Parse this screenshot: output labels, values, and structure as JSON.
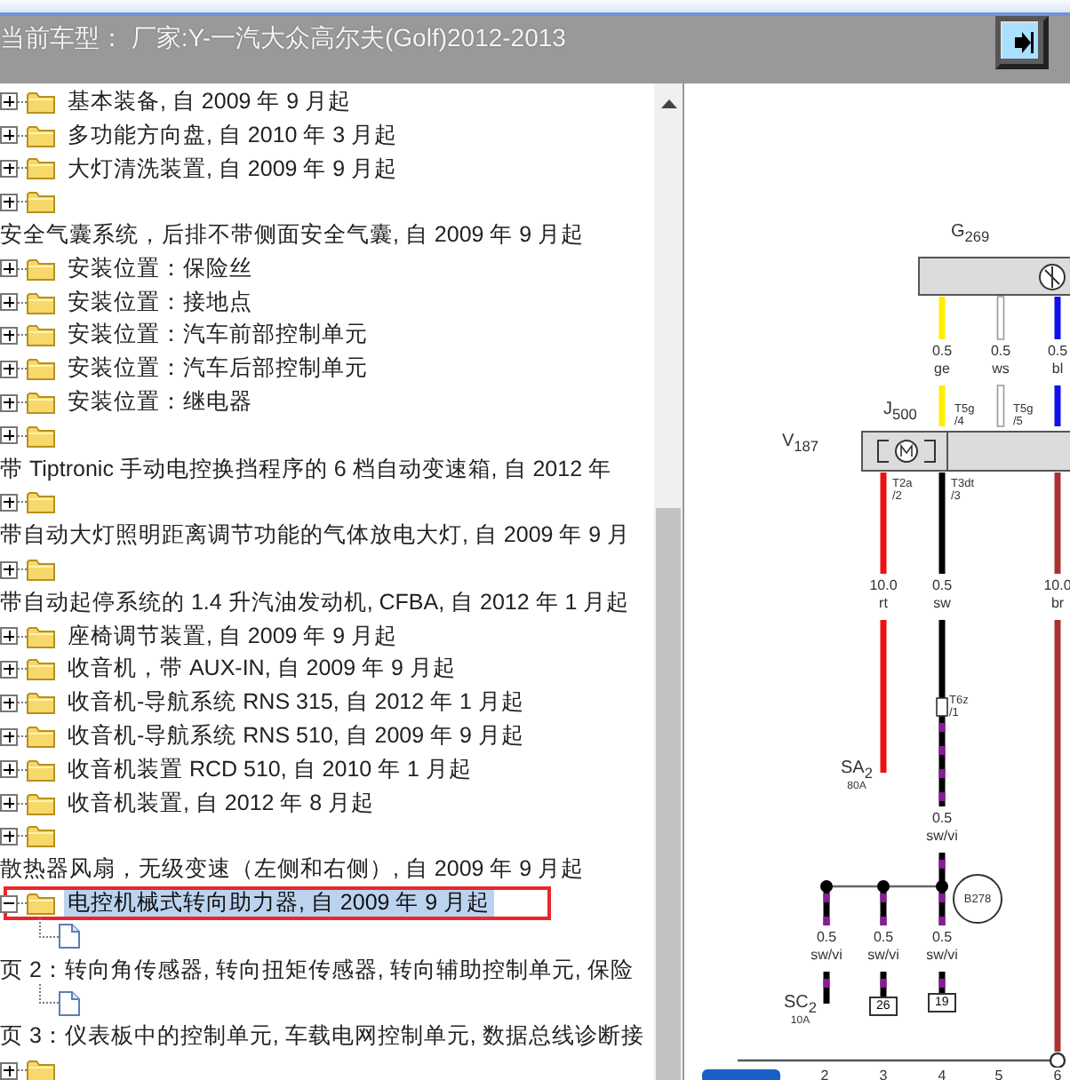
{
  "header": {
    "title": "当前车型： 厂家:Y-一汽大众高尔夫(Golf)2012-2013"
  },
  "tree": [
    {
      "kind": "folder",
      "label": "基本装备, 自 2009 年 9 月起",
      "expanded": false,
      "selected": false,
      "annotated": false
    },
    {
      "kind": "folder",
      "label": "多功能方向盘, 自 2010 年 3 月起",
      "expanded": false,
      "selected": false,
      "annotated": false
    },
    {
      "kind": "folder",
      "label": "大灯清洗装置, 自 2009 年 9 月起",
      "expanded": false,
      "selected": false,
      "annotated": false
    },
    {
      "kind": "folder",
      "expanded": false,
      "selected": false,
      "annotated": false
    },
    {
      "kind": "text",
      "label": "安全气囊系统，后排不带侧面安全气囊, 自 2009 年 9 月起"
    },
    {
      "kind": "folder",
      "label": "安装位置：保险丝",
      "expanded": false,
      "selected": false,
      "annotated": false
    },
    {
      "kind": "folder",
      "label": "安装位置：接地点",
      "expanded": false,
      "selected": false,
      "annotated": false
    },
    {
      "kind": "folder",
      "label": "安装位置：汽车前部控制单元",
      "expanded": false,
      "selected": false,
      "annotated": false
    },
    {
      "kind": "folder",
      "label": "安装位置：汽车后部控制单元",
      "expanded": false,
      "selected": false,
      "annotated": false
    },
    {
      "kind": "folder",
      "label": "安装位置：继电器",
      "expanded": false,
      "selected": false,
      "annotated": false
    },
    {
      "kind": "folder",
      "expanded": false,
      "selected": false,
      "annotated": false
    },
    {
      "kind": "text",
      "label": "带 Tiptronic 手动电控换挡程序的 6 档自动变速箱, 自 2012 年"
    },
    {
      "kind": "folder",
      "expanded": false,
      "selected": false,
      "annotated": false
    },
    {
      "kind": "text",
      "label": "带自动大灯照明距离调节功能的气体放电大灯, 自 2009 年 9 月"
    },
    {
      "kind": "folder",
      "expanded": false,
      "selected": false,
      "annotated": false
    },
    {
      "kind": "text",
      "label": "带自动起停系统的 1.4 升汽油发动机, CFBA, 自 2012 年 1 月起"
    },
    {
      "kind": "folder",
      "label": "座椅调节装置, 自 2009 年 9 月起",
      "expanded": false,
      "selected": false,
      "annotated": false
    },
    {
      "kind": "folder",
      "label": "收音机，带 AUX-IN, 自 2009 年 9 月起",
      "expanded": false,
      "selected": false,
      "annotated": false
    },
    {
      "kind": "folder",
      "label": "收音机-导航系统 RNS 315, 自 2012 年 1 月起",
      "expanded": false,
      "selected": false,
      "annotated": false
    },
    {
      "kind": "folder",
      "label": "收音机-导航系统 RNS 510, 自 2009 年 9 月起",
      "expanded": false,
      "selected": false,
      "annotated": false
    },
    {
      "kind": "folder",
      "label": "收音机装置 RCD 510, 自 2010 年 1 月起",
      "expanded": false,
      "selected": false,
      "annotated": false
    },
    {
      "kind": "folder",
      "label": "收音机装置, 自 2012 年 8 月起",
      "expanded": false,
      "selected": false,
      "annotated": false
    },
    {
      "kind": "folder",
      "expanded": false,
      "selected": false,
      "annotated": false
    },
    {
      "kind": "text",
      "label": "散热器风扇，无级变速（左侧和右侧）, 自 2009 年 9 月起"
    },
    {
      "kind": "folder",
      "label": "电控机械式转向助力器, 自 2009 年 9 月起",
      "expanded": true,
      "selected": true,
      "annotated": true,
      "children": [
        {
          "kind": "doc"
        },
        {
          "kind": "text",
          "label": "页 2：转向角传感器, 转向扭矩传感器, 转向辅助控制单元, 保险"
        },
        {
          "kind": "doc"
        },
        {
          "kind": "text",
          "label": "页 3：仪表板中的控制单元, 车载电网控制单元, 数据总线诊断接"
        }
      ]
    },
    {
      "kind": "folder",
      "expanded": false,
      "selected": false,
      "annotated": false
    }
  ],
  "diagram": {
    "components": [
      {
        "label": "G$_{269}$"
      },
      {
        "label": "J$_{500}$"
      },
      {
        "label": "V$_{187}$"
      },
      {
        "label": "SA$_{2}$",
        "rating": "80A"
      },
      {
        "label": "SC$_{2}$",
        "rating": "10A"
      },
      {
        "label": "B278"
      }
    ],
    "wires": [
      {
        "size": "0.5",
        "code": "ge",
        "color": "#ffee00",
        "kind": "plain"
      },
      {
        "size": "0.5",
        "code": "ws",
        "color": "#ffffff",
        "kind": "plain"
      },
      {
        "size": "0.5",
        "code": "bl",
        "color": "#1010ee",
        "kind": "plain"
      },
      {
        "size": "10.0",
        "code": "rt",
        "color": "#ee1111",
        "kind": "plain"
      },
      {
        "size": "0.5",
        "code": "sw",
        "color": "#000000",
        "kind": "plain"
      },
      {
        "size": "10.0",
        "code": "br",
        "color": "#a83232",
        "kind": "plain"
      },
      {
        "size": "0.5",
        "code": "sw/vi",
        "color": "#000000",
        "kind": "striped"
      },
      {
        "size": "0.5",
        "code": "sw/vi",
        "color": "#000000",
        "kind": "striped"
      },
      {
        "size": "0.5",
        "code": "sw/vi",
        "color": "#000000",
        "kind": "striped"
      },
      {
        "size": "0.5",
        "code": "sw/vi",
        "color": "#000000",
        "kind": "striped"
      }
    ],
    "pins": [
      {
        "name": "T5g",
        "pin": "/4"
      },
      {
        "name": "T5g",
        "pin": "/5"
      },
      {
        "name": "T2a",
        "pin": "/2"
      },
      {
        "name": "T3dt",
        "pin": "/3"
      },
      {
        "name": "T6z",
        "pin": "/1"
      }
    ],
    "terminals": [
      "26",
      "19"
    ],
    "axis": [
      "2",
      "3",
      "4",
      "5",
      "6"
    ]
  }
}
